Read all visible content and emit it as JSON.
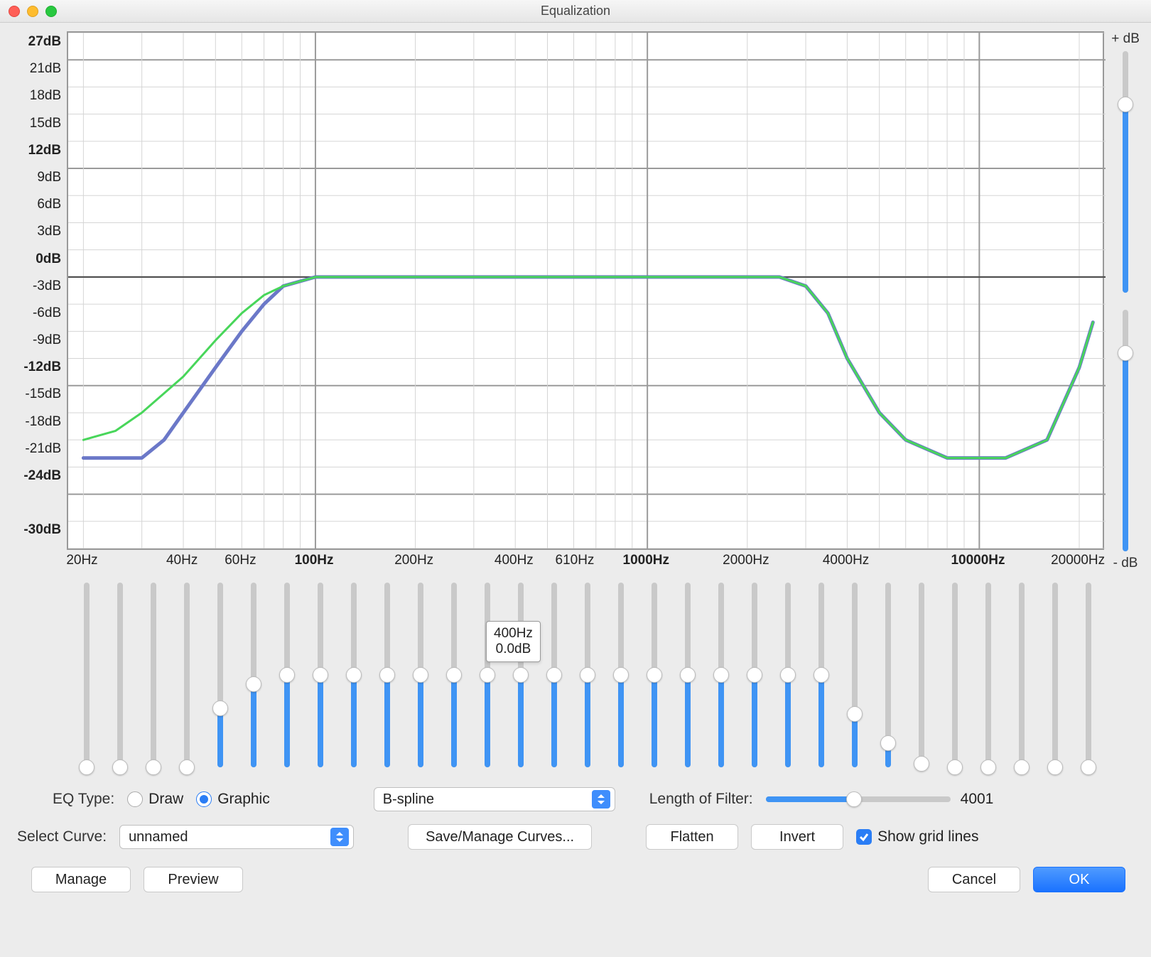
{
  "window": {
    "title": "Equalization"
  },
  "chart_data": {
    "type": "line",
    "title": "",
    "xlabel_hz": true,
    "ylabel_db": true,
    "ylim": [
      -30,
      27
    ],
    "xlog": true,
    "y_ticks": [
      "27dB",
      "21dB",
      "18dB",
      "15dB",
      "12dB",
      "9dB",
      "6dB",
      "3dB",
      "0dB",
      "-3dB",
      "-6dB",
      "-9dB",
      "-12dB",
      "-15dB",
      "-18dB",
      "-21dB",
      "-24dB",
      "",
      "-30dB"
    ],
    "y_bold": [
      0,
      4,
      8,
      12,
      16,
      18
    ],
    "x_ticks": [
      {
        "hz": 20,
        "label": "20Hz"
      },
      {
        "hz": 40,
        "label": "40Hz"
      },
      {
        "hz": 60,
        "label": "60Hz"
      },
      {
        "hz": 100,
        "label": "100Hz",
        "bold": true
      },
      {
        "hz": 200,
        "label": "200Hz"
      },
      {
        "hz": 400,
        "label": "400Hz"
      },
      {
        "hz": 610,
        "label": "610Hz"
      },
      {
        "hz": 1000,
        "label": "1000Hz",
        "bold": true
      },
      {
        "hz": 2000,
        "label": "2000Hz"
      },
      {
        "hz": 4000,
        "label": "4000Hz"
      },
      {
        "hz": 10000,
        "label": "10000Hz",
        "bold": true
      },
      {
        "hz": 20000,
        "label": "20000Hz"
      }
    ],
    "series": [
      {
        "name": "blue",
        "color": "#6b78c8",
        "points": [
          {
            "hz": 20,
            "db": -20
          },
          {
            "hz": 25,
            "db": -20
          },
          {
            "hz": 30,
            "db": -20
          },
          {
            "hz": 35,
            "db": -18
          },
          {
            "hz": 40,
            "db": -15
          },
          {
            "hz": 50,
            "db": -10
          },
          {
            "hz": 60,
            "db": -6
          },
          {
            "hz": 70,
            "db": -3
          },
          {
            "hz": 80,
            "db": -1
          },
          {
            "hz": 100,
            "db": 0
          },
          {
            "hz": 1000,
            "db": 0
          },
          {
            "hz": 2500,
            "db": 0
          },
          {
            "hz": 3000,
            "db": -1
          },
          {
            "hz": 3500,
            "db": -4
          },
          {
            "hz": 4000,
            "db": -9
          },
          {
            "hz": 5000,
            "db": -15
          },
          {
            "hz": 6000,
            "db": -18
          },
          {
            "hz": 8000,
            "db": -20
          },
          {
            "hz": 12000,
            "db": -20
          },
          {
            "hz": 16000,
            "db": -18
          },
          {
            "hz": 20000,
            "db": -10
          },
          {
            "hz": 22000,
            "db": -5
          }
        ]
      },
      {
        "name": "green",
        "color": "#48d65a",
        "points": [
          {
            "hz": 20,
            "db": -18
          },
          {
            "hz": 25,
            "db": -17
          },
          {
            "hz": 30,
            "db": -15
          },
          {
            "hz": 40,
            "db": -11
          },
          {
            "hz": 50,
            "db": -7
          },
          {
            "hz": 60,
            "db": -4
          },
          {
            "hz": 70,
            "db": -2
          },
          {
            "hz": 80,
            "db": -1
          },
          {
            "hz": 100,
            "db": 0
          },
          {
            "hz": 1000,
            "db": 0
          },
          {
            "hz": 2500,
            "db": 0
          },
          {
            "hz": 3000,
            "db": -1
          },
          {
            "hz": 3500,
            "db": -4
          },
          {
            "hz": 4000,
            "db": -9
          },
          {
            "hz": 5000,
            "db": -15
          },
          {
            "hz": 6000,
            "db": -18
          },
          {
            "hz": 8000,
            "db": -20
          },
          {
            "hz": 12000,
            "db": -20
          },
          {
            "hz": 16000,
            "db": -18
          },
          {
            "hz": 20000,
            "db": -10
          },
          {
            "hz": 22000,
            "db": -5
          }
        ]
      }
    ]
  },
  "right_sliders": {
    "top_label": "+ dB",
    "bottom_label": "- dB",
    "top_value_pct": 78,
    "bottom_value_pct": 82
  },
  "bands": [
    {
      "idx": 0,
      "pct": 0
    },
    {
      "idx": 1,
      "pct": 0
    },
    {
      "idx": 2,
      "pct": 0
    },
    {
      "idx": 3,
      "pct": 0
    },
    {
      "idx": 4,
      "pct": 32
    },
    {
      "idx": 5,
      "pct": 45
    },
    {
      "idx": 6,
      "pct": 50
    },
    {
      "idx": 7,
      "pct": 50
    },
    {
      "idx": 8,
      "pct": 50
    },
    {
      "idx": 9,
      "pct": 50
    },
    {
      "idx": 10,
      "pct": 50
    },
    {
      "idx": 11,
      "pct": 50
    },
    {
      "idx": 12,
      "pct": 50
    },
    {
      "idx": 13,
      "pct": 50
    },
    {
      "idx": 14,
      "pct": 50
    },
    {
      "idx": 15,
      "pct": 50
    },
    {
      "idx": 16,
      "pct": 50
    },
    {
      "idx": 17,
      "pct": 50
    },
    {
      "idx": 18,
      "pct": 50
    },
    {
      "idx": 19,
      "pct": 50
    },
    {
      "idx": 20,
      "pct": 50
    },
    {
      "idx": 21,
      "pct": 50
    },
    {
      "idx": 22,
      "pct": 50
    },
    {
      "idx": 23,
      "pct": 29
    },
    {
      "idx": 24,
      "pct": 13
    },
    {
      "idx": 25,
      "pct": 2
    },
    {
      "idx": 26,
      "pct": 0
    },
    {
      "idx": 27,
      "pct": 0
    },
    {
      "idx": 28,
      "pct": 0
    },
    {
      "idx": 29,
      "pct": 0
    },
    {
      "idx": 30,
      "pct": 0
    }
  ],
  "tooltip": {
    "line1": "400Hz",
    "line2": "0.0dB"
  },
  "controls": {
    "eq_type_label": "EQ Type:",
    "draw_label": "Draw",
    "graphic_label": "Graphic",
    "eq_type_selected": "graphic",
    "interp_value": "B-spline",
    "length_label": "Length of Filter:",
    "length_value": "4001",
    "length_pct": 48,
    "select_curve_label": "Select Curve:",
    "select_curve_value": "unnamed",
    "save_manage_label": "Save/Manage Curves...",
    "flatten_label": "Flatten",
    "invert_label": "Invert",
    "gridlines_label": "Show grid lines",
    "gridlines_checked": true,
    "manage_label": "Manage",
    "preview_label": "Preview",
    "cancel_label": "Cancel",
    "ok_label": "OK"
  }
}
